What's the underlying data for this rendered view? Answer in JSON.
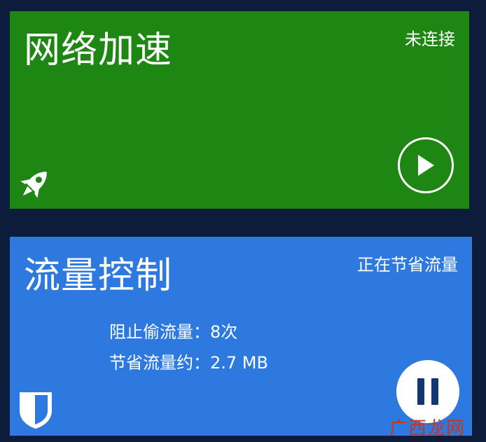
{
  "accelerator": {
    "title": "网络加速",
    "status": "未连接",
    "play_icon": "play-icon",
    "rocket_icon": "rocket-icon",
    "color": "#1e8612"
  },
  "traffic": {
    "title": "流量控制",
    "status": "正在节省流量",
    "blocked_label": "阻止偷流量：8次",
    "saved_label": "节省流量约：2.7 MB",
    "pause_icon": "pause-icon",
    "shield_icon": "shield-icon",
    "color": "#2e79df"
  },
  "watermark": "广西龙网"
}
